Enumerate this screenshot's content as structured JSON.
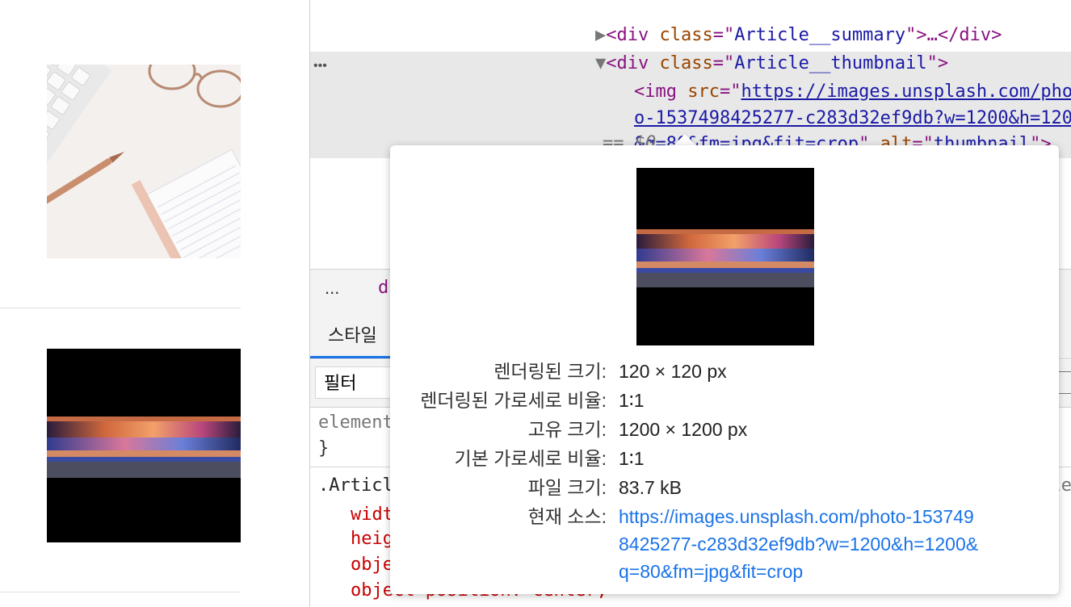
{
  "elements_tree": {
    "line1": {
      "open": "<div",
      "attr": "class",
      "value": "Article__summary",
      "tail": ">…</div>"
    },
    "line2": {
      "open": "<div",
      "attr": "class",
      "value": "Article__thumbnail",
      "tail": ">"
    },
    "ellipsis": "•••",
    "img": {
      "open": "<img",
      "src_attr": "src",
      "src_part1": "https://images.unsplash.com/pho",
      "src_part2": "o-1537498425277-c283d32ef9db?w=1200&h=120",
      "src_part3": "&q=80&fm=jpg&fit=crop",
      "alt_attr": "alt",
      "alt_value": "thumbnail",
      "close": ">"
    },
    "dollar": "== $0"
  },
  "breadcrumb": {
    "ellipsis": "...",
    "item": "d"
  },
  "tabs": {
    "styles": "스타일"
  },
  "filter": {
    "placeholder": "필터"
  },
  "styles_pane": {
    "element_rule": "element",
    "element_close": "}",
    "article_selector": ".Articl",
    "props": [
      "widt",
      "heig",
      "obje",
      "object-position: center;"
    ],
    "right_fragment": "le"
  },
  "tooltip": {
    "rows": [
      {
        "label": "렌더링된 크기:",
        "value": "120 × 120 px"
      },
      {
        "label": "렌더링된 가로세로 비율:",
        "value": "1∶1"
      },
      {
        "label": "고유 크기:",
        "value": "1200 × 1200 px"
      },
      {
        "label": "기본 가로세로 비율:",
        "value": "1∶1"
      },
      {
        "label": "파일 크기:",
        "value": "83.7 kB"
      },
      {
        "label": "현재 소스:",
        "value_lines": [
          "https://images.unsplash.com/photo-153749",
          "8425277-c283d32ef9db?w=1200&h=1200&",
          "q=80&fm=jpg&fit=crop"
        ]
      }
    ]
  },
  "colors": {
    "accent": "#1a73e8",
    "tag": "#881280",
    "attr": "#994500",
    "val": "#1a1aa6"
  }
}
